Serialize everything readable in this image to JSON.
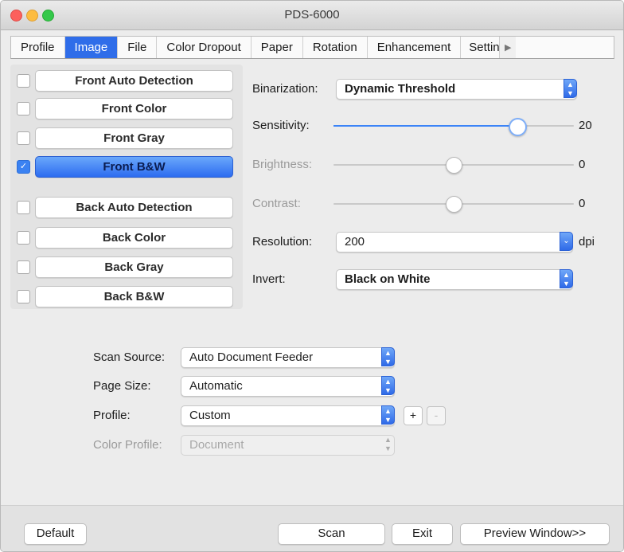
{
  "window": {
    "title": "PDS-6000"
  },
  "tabs": [
    {
      "label": "Profile"
    },
    {
      "label": "Image"
    },
    {
      "label": "File"
    },
    {
      "label": "Color Dropout"
    },
    {
      "label": "Paper"
    },
    {
      "label": "Rotation"
    },
    {
      "label": "Enhancement"
    },
    {
      "label": "Setting"
    }
  ],
  "image_types": [
    {
      "label": "Front Auto Detection",
      "checked": false
    },
    {
      "label": "Front Color",
      "checked": false
    },
    {
      "label": "Front Gray",
      "checked": false
    },
    {
      "label": "Front B&W",
      "checked": true
    },
    {
      "label": "Back Auto Detection",
      "checked": false
    },
    {
      "label": "Back Color",
      "checked": false
    },
    {
      "label": "Back Gray",
      "checked": false
    },
    {
      "label": "Back B&W",
      "checked": false
    }
  ],
  "settings": {
    "binarization_label": "Binarization:",
    "binarization_value": "Dynamic Threshold",
    "sensitivity_label": "Sensitivity:",
    "sensitivity_value": "20",
    "sensitivity_fraction": 0.76,
    "brightness_label": "Brightness:",
    "brightness_value": "0",
    "brightness_fraction": 0.5,
    "contrast_label": "Contrast:",
    "contrast_value": "0",
    "contrast_fraction": 0.5,
    "resolution_label": "Resolution:",
    "resolution_value": "200",
    "resolution_unit": "dpi",
    "invert_label": "Invert:",
    "invert_value": "Black on White"
  },
  "scan": {
    "source_label": "Scan Source:",
    "source_value": "Auto Document Feeder",
    "pagesize_label": "Page Size:",
    "pagesize_value": "Automatic",
    "profile_label": "Profile:",
    "profile_value": "Custom",
    "add_label": "+",
    "remove_label": "-",
    "colorprofile_label": "Color Profile:",
    "colorprofile_value": "Document"
  },
  "footer": {
    "default_label": "Default",
    "scan_label": "Scan",
    "exit_label": "Exit",
    "preview_label": "Preview Window>>"
  },
  "colors": {
    "accent": "#2f6de9",
    "slider_fill": "#3c84f7"
  }
}
